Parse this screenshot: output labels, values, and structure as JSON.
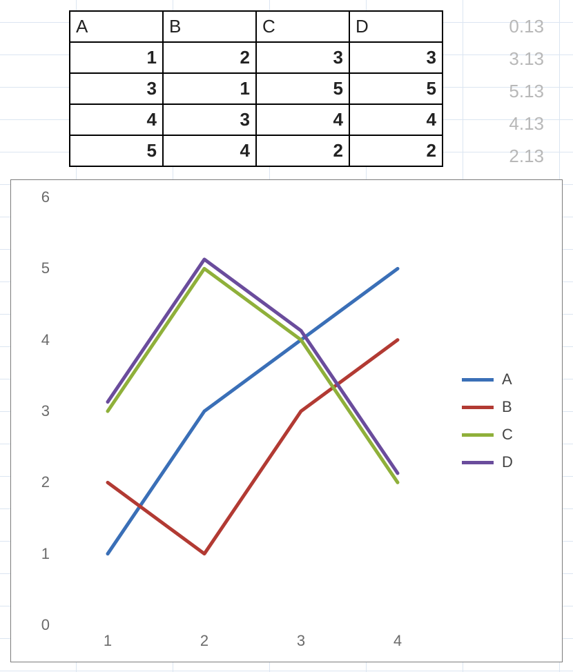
{
  "table": {
    "headers": [
      "A",
      "B",
      "C",
      "D"
    ],
    "rows": [
      [
        1,
        2,
        3,
        3
      ],
      [
        3,
        1,
        5,
        5
      ],
      [
        4,
        3,
        4,
        4
      ],
      [
        5,
        4,
        2,
        2
      ]
    ]
  },
  "extra_column": [
    "0.13",
    "3.13",
    "5.13",
    "4.13",
    "2.13"
  ],
  "chart_data": {
    "type": "line",
    "categories": [
      "1",
      "2",
      "3",
      "4"
    ],
    "series": [
      {
        "name": "A",
        "values": [
          1,
          3,
          4,
          5
        ],
        "color": "#3a6fb7"
      },
      {
        "name": "B",
        "values": [
          2,
          1,
          3,
          4
        ],
        "color": "#b23a33"
      },
      {
        "name": "C",
        "values": [
          3,
          5,
          4,
          2
        ],
        "color": "#8fb03a"
      },
      {
        "name": "D",
        "values": [
          3.13,
          5.13,
          4.13,
          2.13
        ],
        "color": "#6a4c9c"
      }
    ],
    "ylim": [
      0,
      6
    ],
    "yticks": [
      0,
      1,
      2,
      3,
      4,
      5,
      6
    ],
    "xlabel": "",
    "ylabel": "",
    "title": ""
  }
}
